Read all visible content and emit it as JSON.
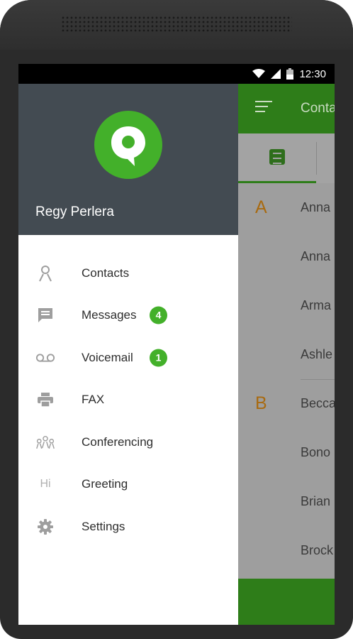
{
  "status_bar": {
    "time": "12:30"
  },
  "drawer": {
    "user_name": "Regy Perlera",
    "menu": [
      {
        "label": "Contacts",
        "icon": "person-icon"
      },
      {
        "label": "Messages",
        "icon": "message-icon",
        "badge": "4"
      },
      {
        "label": "Voicemail",
        "icon": "voicemail-icon",
        "badge": "1"
      },
      {
        "label": "FAX",
        "icon": "printer-icon"
      },
      {
        "label": "Conferencing",
        "icon": "group-icon"
      },
      {
        "label": "Greeting",
        "icon": "hi-icon",
        "icon_text": "Hi"
      },
      {
        "label": "Settings",
        "icon": "gear-icon"
      }
    ]
  },
  "background_app": {
    "toolbar_title": "Conta",
    "sections": [
      {
        "letter": "A",
        "names": [
          "Anna",
          "Anna",
          "Arma",
          "Ashle"
        ]
      },
      {
        "letter": "B",
        "names": [
          "Becca",
          "Bono",
          "Brian",
          "Brock"
        ]
      }
    ]
  },
  "colors": {
    "brand_green": "#43b02a",
    "toolbar_green": "#2e7d19",
    "header_gray": "#434b52",
    "section_letter": "#a86a10"
  }
}
